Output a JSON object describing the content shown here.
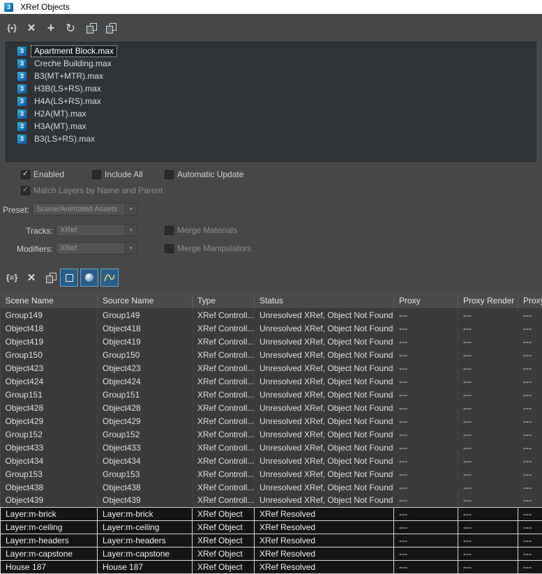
{
  "window": {
    "title": "XRef Objects"
  },
  "icons": {
    "max_logo": "3",
    "braces_square": "{▪}",
    "braces_list": "{≡}",
    "delete": "×",
    "add": "+",
    "refresh": "↻",
    "dropdown": "▼",
    "check": "✓"
  },
  "file_list": {
    "items": [
      {
        "label": "Apartment Block.max",
        "selected": true
      },
      {
        "label": "Creche Building.max",
        "selected": false
      },
      {
        "label": "B3(MT+MTR).max",
        "selected": false
      },
      {
        "label": "H3B(LS+RS).max",
        "selected": false
      },
      {
        "label": "H4A(LS+RS).max",
        "selected": false
      },
      {
        "label": "H2A(MT).max",
        "selected": false
      },
      {
        "label": "H3A(MT).max",
        "selected": false
      },
      {
        "label": "B3(LS+RS).max",
        "selected": false
      }
    ]
  },
  "checkboxes": {
    "enabled": {
      "label": "Enabled",
      "checked": true,
      "disabled": false
    },
    "include_all": {
      "label": "Include All",
      "checked": false,
      "disabled": false
    },
    "automatic_update": {
      "label": "Automatic Update",
      "checked": false,
      "disabled": false
    },
    "match_layers": {
      "label": "Match Layers by Name and Parent",
      "checked": true,
      "disabled": true
    },
    "merge_materials": {
      "label": "Merge Materials",
      "checked": false,
      "disabled": true
    },
    "merge_manipulators": {
      "label": "Merge Manipulators",
      "checked": false,
      "disabled": true
    }
  },
  "preset": {
    "label": "Preset:",
    "value": "Scene/Animated Assets"
  },
  "tracks": {
    "label": "Tracks:",
    "value": "XRef"
  },
  "modifiers": {
    "label": "Modifiers:",
    "value": "XRef"
  },
  "table": {
    "columns": [
      "Scene Name",
      "Source Name",
      "Type",
      "Status",
      "Proxy",
      "Proxy Render",
      "Proxy"
    ],
    "rows": [
      {
        "selected": false,
        "cells": [
          "Group149",
          "Group149",
          "XRef Controll...",
          "Unresolved XRef, Object Not Found",
          "---",
          "---",
          "---"
        ]
      },
      {
        "selected": false,
        "cells": [
          "Object418",
          "Object418",
          "XRef Controll...",
          "Unresolved XRef, Object Not Found",
          "---",
          "---",
          "---"
        ]
      },
      {
        "selected": false,
        "cells": [
          "Object419",
          "Object419",
          "XRef Controll...",
          "Unresolved XRef, Object Not Found",
          "---",
          "---",
          "---"
        ]
      },
      {
        "selected": false,
        "cells": [
          "Group150",
          "Group150",
          "XRef Controll...",
          "Unresolved XRef, Object Not Found",
          "---",
          "---",
          "---"
        ]
      },
      {
        "selected": false,
        "cells": [
          "Object423",
          "Object423",
          "XRef Controll...",
          "Unresolved XRef, Object Not Found",
          "---",
          "---",
          "---"
        ]
      },
      {
        "selected": false,
        "cells": [
          "Object424",
          "Object424",
          "XRef Controll...",
          "Unresolved XRef, Object Not Found",
          "---",
          "---",
          "---"
        ]
      },
      {
        "selected": false,
        "cells": [
          "Group151",
          "Group151",
          "XRef Controll...",
          "Unresolved XRef, Object Not Found",
          "---",
          "---",
          "---"
        ]
      },
      {
        "selected": false,
        "cells": [
          "Object428",
          "Object428",
          "XRef Controll...",
          "Unresolved XRef, Object Not Found",
          "---",
          "---",
          "---"
        ]
      },
      {
        "selected": false,
        "cells": [
          "Object429",
          "Object429",
          "XRef Controll...",
          "Unresolved XRef, Object Not Found",
          "---",
          "---",
          "---"
        ]
      },
      {
        "selected": false,
        "cells": [
          "Group152",
          "Group152",
          "XRef Controll...",
          "Unresolved XRef, Object Not Found",
          "---",
          "---",
          "---"
        ]
      },
      {
        "selected": false,
        "cells": [
          "Object433",
          "Object433",
          "XRef Controll...",
          "Unresolved XRef, Object Not Found",
          "---",
          "---",
          "---"
        ]
      },
      {
        "selected": false,
        "cells": [
          "Object434",
          "Object434",
          "XRef Controll...",
          "Unresolved XRef, Object Not Found",
          "---",
          "---",
          "---"
        ]
      },
      {
        "selected": false,
        "cells": [
          "Group153",
          "Group153",
          "XRef Controll...",
          "Unresolved XRef, Object Not Found",
          "---",
          "---",
          "---"
        ]
      },
      {
        "selected": false,
        "cells": [
          "Object438",
          "Object438",
          "XRef Controll...",
          "Unresolved XRef, Object Not Found",
          "---",
          "---",
          "---"
        ]
      },
      {
        "selected": false,
        "cells": [
          "Object439",
          "Object439",
          "XRef Controll...",
          "Unresolved XRef, Object Not Found",
          "---",
          "---",
          "---"
        ]
      },
      {
        "selected": true,
        "cells": [
          "Layer:m-brick",
          "Layer:m-brick",
          "XRef Object",
          "XRef Resolved",
          "---",
          "---",
          "---"
        ]
      },
      {
        "selected": true,
        "cells": [
          "Layer:m-ceiling",
          "Layer:m-ceiling",
          "XRef Object",
          "XRef Resolved",
          "---",
          "---",
          "---"
        ]
      },
      {
        "selected": true,
        "cells": [
          "Layer:m-headers",
          "Layer:m-headers",
          "XRef Object",
          "XRef Resolved",
          "---",
          "---",
          "---"
        ]
      },
      {
        "selected": true,
        "cells": [
          "Layer:m-capstone",
          "Layer:m-capstone",
          "XRef Object",
          "XRef Resolved",
          "---",
          "---",
          "---"
        ]
      },
      {
        "selected": true,
        "cells": [
          "House 187",
          "House 187",
          "XRef Object",
          "XRef Resolved",
          "---",
          "---",
          "---"
        ]
      }
    ]
  }
}
